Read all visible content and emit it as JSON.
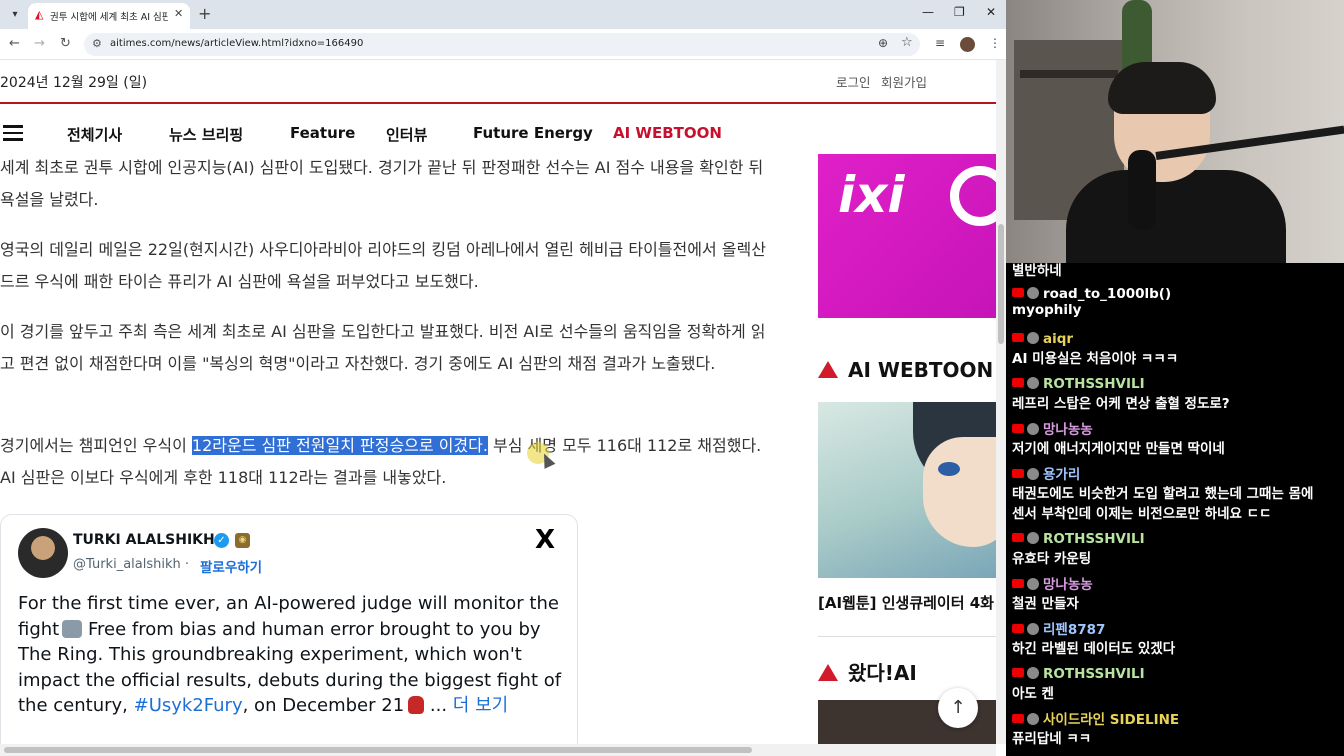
{
  "browser": {
    "tab_title": "권투 시합에 세계 최초 AI 심판",
    "url": "aitimes.com/news/articleView.html?idxno=166490"
  },
  "site": {
    "date": "2024년 12월 29일 (일)",
    "login": "로그인",
    "signup": "회원가입",
    "nav": [
      "전체기사",
      "뉴스 브리핑",
      "Feature",
      "인터뷰",
      "Future Energy",
      "AI WEBTOON"
    ],
    "accent_color": "#c8102e"
  },
  "article": {
    "p1": "세계 최초로 권투 시합에 인공지능(AI) 심판이 도입됐다. 경기가 끝난 뒤 판정패한 선수는 AI 점수 내용을 확인한 뒤 욕설을 날렸다.",
    "p2": "영국의 데일리 메일은 22일(현지시간) 사우디아라비아 리야드의 킹덤 아레나에서 열린 헤비급 타이틀전에서 올렉산드르 우식에 패한 타이슨 퓨리가 AI 심판에 욕설을 퍼부었다고 보도했다.",
    "p3": "이 경기를 앞두고 주최 측은 세계 최초로 AI 심판을 도입한다고 발표했다. 비전 AI로 선수들의 움직임을 정확하게 읽고 편견 없이 채점한다며 이를 \"복싱의 혁명\"이라고 자찬했다. 경기 중에도 AI 심판의 채점 결과가 노출됐다.",
    "p4_before": "경기에서는 챔피언인 우식이 ",
    "p4_highlight": "12라운드 심판 전원일치 판정승으로 이겼다.",
    "p4_after": " 부심 세명 모두 116대 112로 채점했다. AI 심판은 이보다 우식에게 후한 118대 112라는 결과를 내놓았다."
  },
  "tweet": {
    "name": "TURKI ALALSHIKH",
    "handle": "@Turki_alalshikh",
    "separator": "·",
    "follow": "팔로우하기",
    "text_a": "For the first time ever, an AI-powered judge will monitor the fight",
    "text_b": " Free from bias and human error brought to you by The Ring. This groundbreaking experiment, which won't impact the official results, debuts during the biggest fight of the century, ",
    "hashtag": "#Usyk2Fury",
    "text_c": ", on December 21",
    "ellipsis": " ... ",
    "more": "더 보기"
  },
  "sidebar": {
    "ad_text": "ixi",
    "section1": "AI WEBTOON",
    "webtoon_caption": "[AI웹툰] 인생큐레이터 4화",
    "section2": "왔다!AI"
  },
  "chat": {
    "top_partial": "별반하네",
    "messages": [
      {
        "user": "road_to_1000lb()",
        "msg": "myophily",
        "color": "#ffffff"
      },
      {
        "user": "aiqr",
        "msg": "AI 미용실은 처음이야 ㅋㅋㅋ",
        "color": "#e8d35a"
      },
      {
        "user": "ROTHSSHVILI",
        "msg": "레프리 스탑은 어케 면상 출혈 정도로?",
        "color": "#b7e4a0"
      },
      {
        "user": "망나농농",
        "msg": "저기에 애너지게이지만 만들면 딱이네",
        "color": "#d79be0"
      },
      {
        "user": "용가리",
        "msg": "태권도에도 비슷한거 도입 할려고 했는데 그때는 몸에",
        "msg2": "센서 부착인데 이제는 비전으로만 하네요 ㄷㄷ",
        "color": "#9fc6ff"
      },
      {
        "user": "ROTHSSHVILI",
        "msg": "유효타 카운팅",
        "color": "#b7e4a0"
      },
      {
        "user": "망나농농",
        "msg": "철권 만들자",
        "color": "#d79be0"
      },
      {
        "user": "리펜8787",
        "msg": "하긴 라벨된 데이터도 있겠다",
        "color": "#9fc6ff"
      },
      {
        "user": "ROTHSSHVILI",
        "msg": "아도 켄",
        "color": "#b7e4a0"
      },
      {
        "user": "사이드라인 SIDELINE",
        "msg": "퓨리답네 ㅋㅋ",
        "color": "#e8d35a"
      }
    ]
  }
}
